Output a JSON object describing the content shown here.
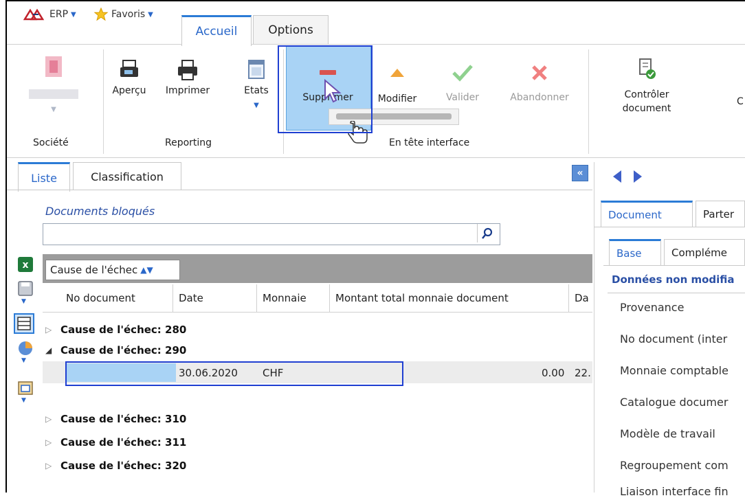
{
  "menu": {
    "erp_label": "ERP",
    "favoris_label": "Favoris",
    "tabs": [
      {
        "label": "Accueil"
      },
      {
        "label": "Options"
      }
    ]
  },
  "ribbon": {
    "societe_group_label": "Société",
    "reporting": {
      "apercu": "Aperçu",
      "imprimer": "Imprimer",
      "etats": "Etats",
      "group_label": "Reporting"
    },
    "entete": {
      "supprimer": "Supprimer",
      "modifier": "Modifier",
      "valider": "Valider",
      "abandonner": "Abandonner",
      "group_label": "En tête interface"
    },
    "controler_line1": "Contrôler",
    "controler_line2": "document",
    "next_partial": "C"
  },
  "left": {
    "tabs": [
      {
        "label": "Liste"
      },
      {
        "label": "Classification"
      }
    ],
    "section_title": "Documents bloqués",
    "search_placeholder": "",
    "group_by": "Cause de l'échec",
    "columns": [
      "No document",
      "Date",
      "Monnaie",
      "Montant total monnaie document",
      "Da"
    ],
    "groups": [
      {
        "label": "Cause de l'échec: 280",
        "expanded": false
      },
      {
        "label": "Cause de l'échec: 290",
        "expanded": true
      },
      {
        "label": "Cause de l'échec: 310",
        "expanded": false
      },
      {
        "label": "Cause de l'échec: 311",
        "expanded": false
      },
      {
        "label": "Cause de l'échec: 320",
        "expanded": false
      }
    ],
    "data_row": {
      "date": "30.06.2020",
      "monnaie": "CHF",
      "montant": "0.00",
      "da": "22."
    }
  },
  "right": {
    "tabs_level1": [
      {
        "label": "Document"
      },
      {
        "label": "Parter"
      }
    ],
    "tabs_level2": [
      {
        "label": "Base"
      },
      {
        "label": "Compléme"
      }
    ],
    "section_title": "Données non modifia",
    "fields": [
      "Provenance",
      "No document (inter",
      "Monnaie comptable",
      "Catalogue documer",
      "Modèle de travail",
      "Regroupement com",
      "Liaison interface fin"
    ]
  },
  "colors": {
    "accent": "#2b7bd6",
    "highlight_box": "#1f3fd1",
    "selected_button_bg": "#a9d3f5",
    "delete_red": "#d9534f"
  }
}
